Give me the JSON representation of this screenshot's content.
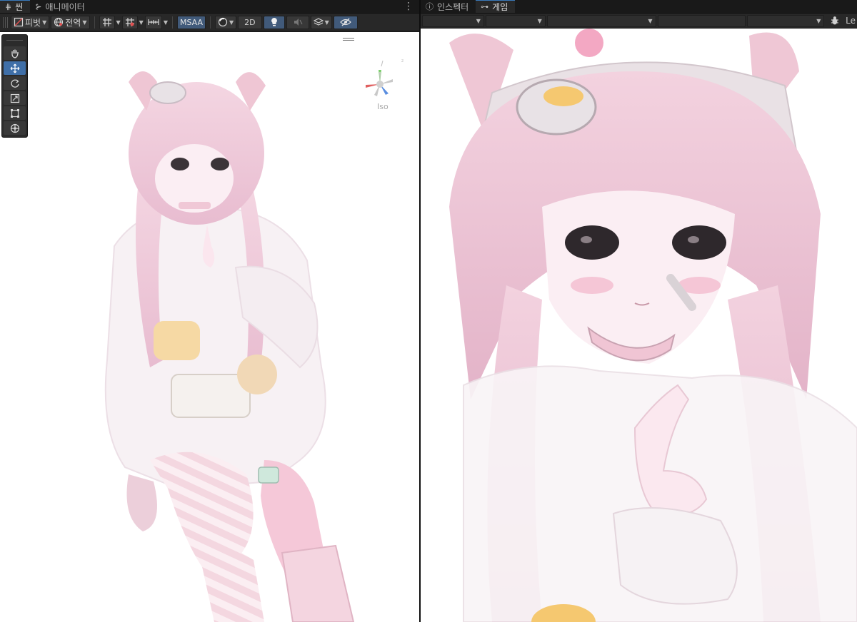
{
  "scene_panel": {
    "tabs": [
      {
        "label": "씬",
        "icon": "grid-icon",
        "active": true
      },
      {
        "label": "애니메이터",
        "icon": "animator-icon",
        "active": false
      }
    ],
    "toolbar": {
      "pivot_label": "피벗",
      "global_label": "전역",
      "msaa_label": "MSAA",
      "two_d_label": "2D"
    },
    "tools": [
      "hand-tool",
      "move-tool",
      "rotate-tool",
      "scale-tool",
      "rect-tool",
      "transform-tool"
    ],
    "active_tool": "move-tool",
    "orientation_label": "Iso"
  },
  "game_panel": {
    "tabs": [
      {
        "label": "인스펙터",
        "icon": "info-icon",
        "active": false
      },
      {
        "label": "게임",
        "icon": "gamepad-icon",
        "active": true
      }
    ],
    "toolbar_text": "Le"
  },
  "colors": {
    "accent": "#3a79bb",
    "active_tool": "#3f6fa8",
    "highlight_button": "#415a7a",
    "panel_bg": "#282828",
    "tab_bg": "#191919"
  }
}
